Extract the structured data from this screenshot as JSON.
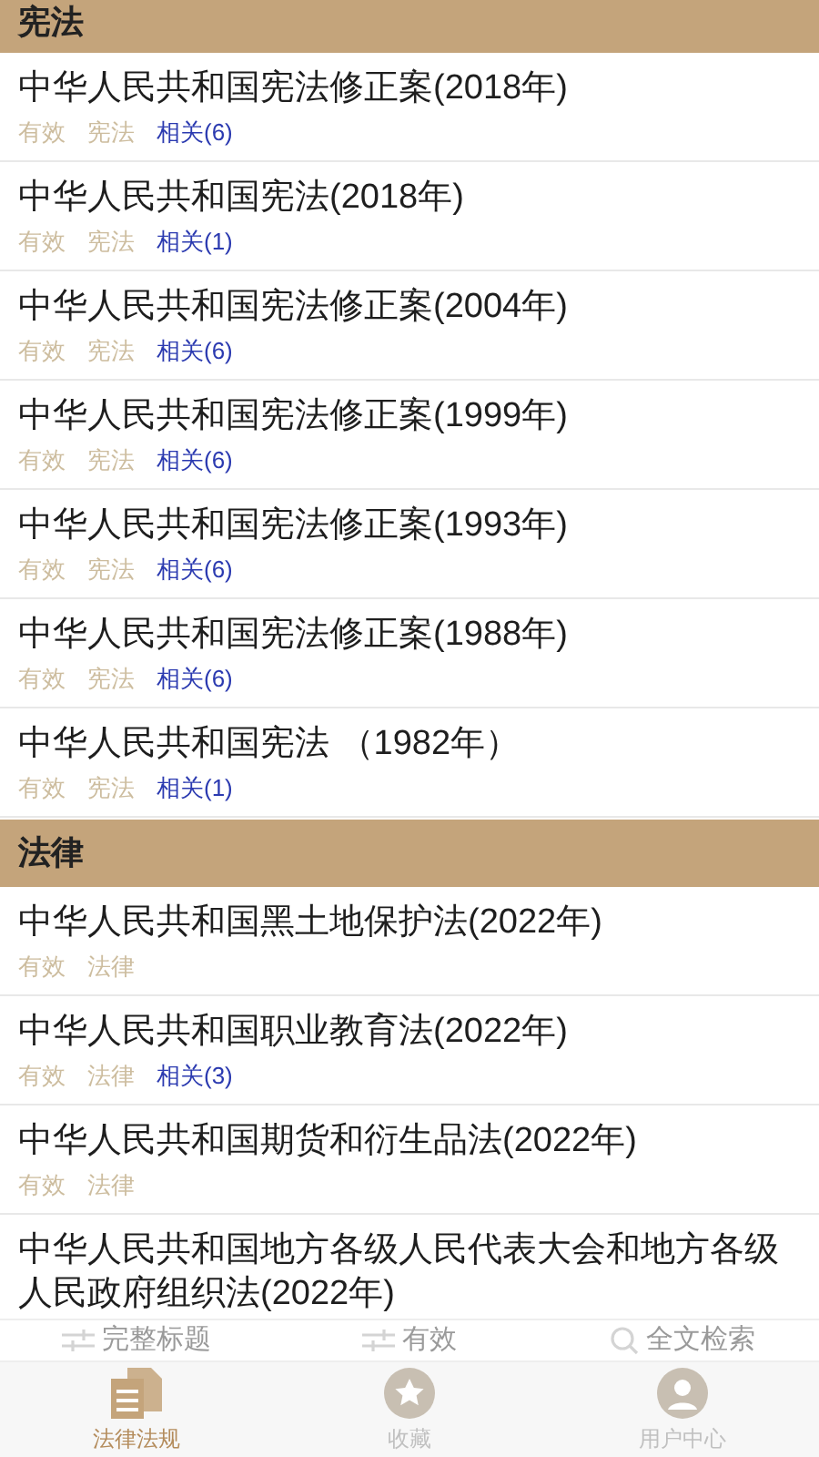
{
  "sections": [
    {
      "title": "宪法",
      "items": [
        {
          "title": "中华人民共和国宪法修正案(2018年)",
          "status": "有效",
          "category": "宪法",
          "related": "相关(6)"
        },
        {
          "title": "中华人民共和国宪法(2018年)",
          "status": "有效",
          "category": "宪法",
          "related": "相关(1)"
        },
        {
          "title": "中华人民共和国宪法修正案(2004年)",
          "status": "有效",
          "category": "宪法",
          "related": "相关(6)"
        },
        {
          "title": "中华人民共和国宪法修正案(1999年)",
          "status": "有效",
          "category": "宪法",
          "related": "相关(6)"
        },
        {
          "title": "中华人民共和国宪法修正案(1993年)",
          "status": "有效",
          "category": "宪法",
          "related": "相关(6)"
        },
        {
          "title": "中华人民共和国宪法修正案(1988年)",
          "status": "有效",
          "category": "宪法",
          "related": "相关(6)"
        },
        {
          "title": "中华人民共和国宪法 （1982年）",
          "status": "有效",
          "category": "宪法",
          "related": "相关(1)"
        }
      ]
    },
    {
      "title": "法律",
      "items": [
        {
          "title": "中华人民共和国黑土地保护法(2022年)",
          "status": "有效",
          "category": "法律"
        },
        {
          "title": "中华人民共和国职业教育法(2022年)",
          "status": "有效",
          "category": "法律",
          "related": "相关(3)"
        },
        {
          "title": "中华人民共和国期货和衍生品法(2022年)",
          "status": "有效",
          "category": "法律"
        },
        {
          "title": "中华人民共和国地方各级人民代表大会和地方各级人民政府组织法(2022年)"
        }
      ]
    }
  ],
  "filters": [
    {
      "kind": "sliders",
      "label": "完整标题"
    },
    {
      "kind": "sliders",
      "label": "有效"
    },
    {
      "kind": "search",
      "label": "全文检索"
    }
  ],
  "tabs": [
    {
      "kind": "docs",
      "label": "法律法规",
      "selected": true
    },
    {
      "kind": "star",
      "label": "收藏",
      "selected": false
    },
    {
      "kind": "user",
      "label": "用户中心",
      "selected": false
    }
  ]
}
